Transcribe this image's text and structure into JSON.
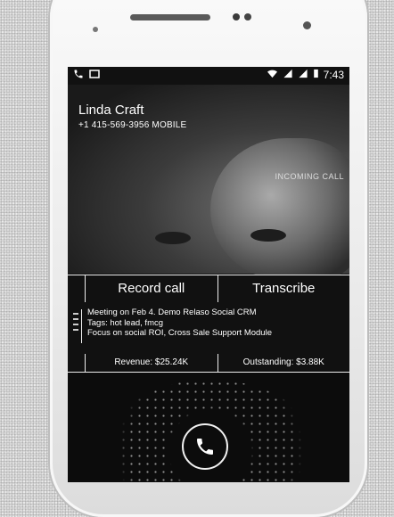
{
  "status_bar": {
    "time": "7:43",
    "left_icons": [
      "phone-icon",
      "media-icon"
    ],
    "right_icons": [
      "wifi-icon",
      "signal-icon",
      "signal-icon-2",
      "battery-icon"
    ]
  },
  "caller": {
    "name": "Linda Craft",
    "number": "+1 415-569-3956 MOBILE",
    "call_state": "INCOMING CALL"
  },
  "actions": {
    "record_label": "Record call",
    "transcribe_label": "Transcribe"
  },
  "notes": {
    "lines": [
      "Meeting on Feb 4. Demo Relaso Social CRM",
      "Tags: hot lead, fmcg",
      "Focus on social ROI, Cross Sale Support Module"
    ]
  },
  "stats": {
    "revenue": "Revenue: $25.24K",
    "outstanding": "Outstanding: $3.88K"
  },
  "answer": {
    "icon": "phone-answer-icon"
  }
}
